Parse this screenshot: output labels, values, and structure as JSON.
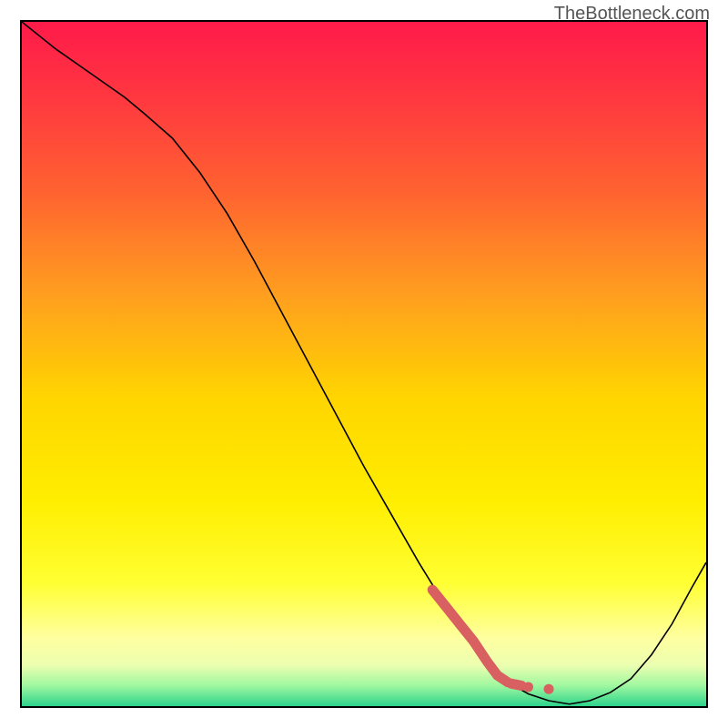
{
  "watermark": "TheBottleneck.com",
  "chart_data": {
    "type": "line",
    "title": "",
    "xlabel": "",
    "ylabel": "",
    "xlim": [
      0,
      100
    ],
    "ylim": [
      0,
      100
    ],
    "series": [
      {
        "name": "main-curve",
        "x": [
          0,
          5,
          10,
          15,
          18,
          22,
          26,
          30,
          34,
          38,
          42,
          46,
          50,
          54,
          58,
          62,
          65,
          68,
          71,
          74,
          77,
          80,
          83,
          86,
          89,
          92,
          95,
          98,
          100
        ],
        "y": [
          100,
          96,
          92.5,
          89,
          86.5,
          83,
          78,
          72,
          65,
          57.5,
          50,
          42.5,
          35,
          28,
          21,
          14.5,
          10,
          6.5,
          3.5,
          1.8,
          0.8,
          0.3,
          0.8,
          2,
          4,
          7.5,
          12,
          17.5,
          21
        ],
        "style": {
          "stroke": "#000000",
          "stroke_width": 1.6
        }
      },
      {
        "name": "highlight-segment",
        "x": [
          60,
          62,
          64,
          66,
          68,
          69.5,
          71
        ],
        "y": [
          17,
          14.5,
          12,
          9.5,
          6.5,
          4.5,
          3.5
        ],
        "style": {
          "stroke": "#d86060",
          "stroke_width": 11,
          "linecap": "round"
        }
      }
    ],
    "markers": [
      {
        "name": "dot-1",
        "x": 74,
        "y": 2.8,
        "r": 5.5,
        "fill": "#d86060"
      },
      {
        "name": "dot-2",
        "x": 77,
        "y": 2.5,
        "r": 5.5,
        "fill": "#d86060"
      },
      {
        "name": "dash-1",
        "type": "dash",
        "x0": 71.5,
        "y0": 3.3,
        "x1": 73,
        "y1": 3.0,
        "stroke": "#d86060",
        "stroke_width": 11
      }
    ],
    "annotations": []
  }
}
